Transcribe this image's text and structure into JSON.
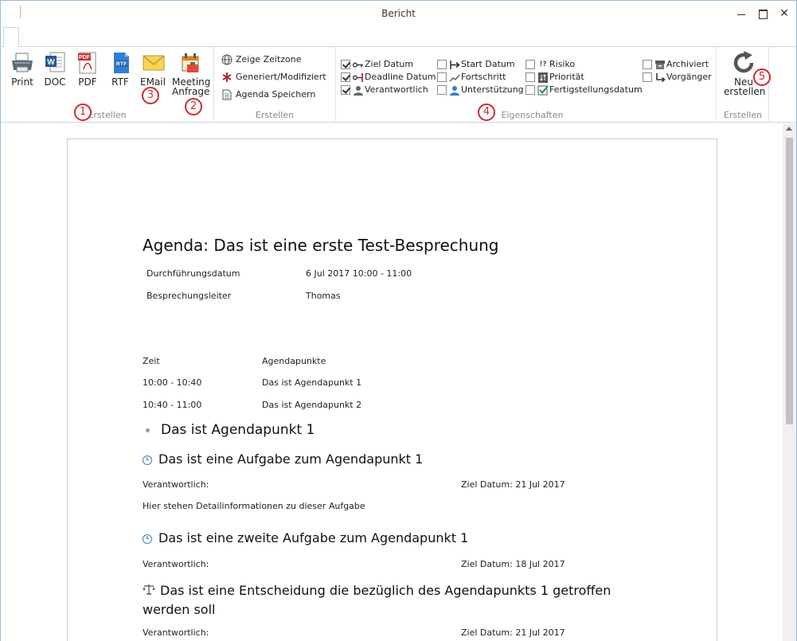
{
  "window": {
    "title": "Bericht"
  },
  "ribbon": {
    "group1": {
      "label": "Erstellen",
      "buttons": {
        "print": "Print",
        "doc": "DOC",
        "pdf": "PDF",
        "rtf": "RTF",
        "email": "EMail",
        "meeting_line1": "Meeting",
        "meeting_line2": "Anfrage"
      }
    },
    "group2": {
      "label": "Erstellen",
      "items": {
        "zeitzone": "Zeige Zeitzone",
        "generiert": "Generiert/Modifiziert",
        "speichern": "Agenda Speichern"
      }
    },
    "group3": {
      "label": "Eigenschaften",
      "properties": [
        {
          "label": "Ziel Datum",
          "checked": true
        },
        {
          "label": "Deadline Datum",
          "checked": true
        },
        {
          "label": "Verantwortlich",
          "checked": true
        },
        {
          "label": "Start Datum",
          "checked": false
        },
        {
          "label": "Fortschritt",
          "checked": false
        },
        {
          "label": "Unterstützung",
          "checked": false
        },
        {
          "label": "Risiko",
          "checked": false
        },
        {
          "label": "Priorität",
          "checked": false
        },
        {
          "label": "Fertigstellungsdatum",
          "checked": false
        },
        {
          "label": "Archiviert",
          "checked": false
        },
        {
          "label": "Vorgänger",
          "checked": false
        }
      ]
    },
    "group4": {
      "label": "Erstellen",
      "button_line1": "Neu",
      "button_line2": "erstellen"
    },
    "badges": [
      "1",
      "2",
      "3",
      "4",
      "5"
    ],
    "pdf_icon_text": "PDF",
    "rtf_icon_text": "RTF",
    "risk_icon_text": "!?"
  },
  "document": {
    "title": "Agenda: Das ist eine erste Test-Besprechung",
    "meta": [
      {
        "key": "Durchführungsdatum",
        "value": "6 Jul 2017 10:00 - 11:00"
      },
      {
        "key": "Besprechungsleiter",
        "value": "Thomas"
      }
    ],
    "schedule_header": {
      "time": "Zeit",
      "item": "Agendapunkte"
    },
    "schedule": [
      {
        "time": "10:00 - 10:40",
        "item": "Das ist Agendapunkt 1"
      },
      {
        "time": "10:40 - 11:00",
        "item": "Das ist Agendapunkt 2"
      }
    ],
    "section1": "Das ist Agendapunkt 1",
    "task1": {
      "title": "Das ist eine Aufgabe zum Agendapunkt 1",
      "responsible": "Verantwortlich:",
      "target": "Ziel Datum: 21 Jul 2017",
      "detail": "Hier stehen Detailinformationen zu dieser Aufgabe"
    },
    "task2": {
      "title": "Das ist eine zweite Aufgabe zum Agendapunkt 1",
      "responsible": "Verantwortlich:",
      "target": "Ziel Datum: 18 Jul 2017"
    },
    "decision1": {
      "title_line1": "Das ist eine Entscheidung die bezüglich des Agendapunkts 1 getroffen",
      "title_line2": "werden soll",
      "responsible": "Verantwortlich:",
      "target": "Ziel Datum: 21 Jul 2017"
    }
  }
}
